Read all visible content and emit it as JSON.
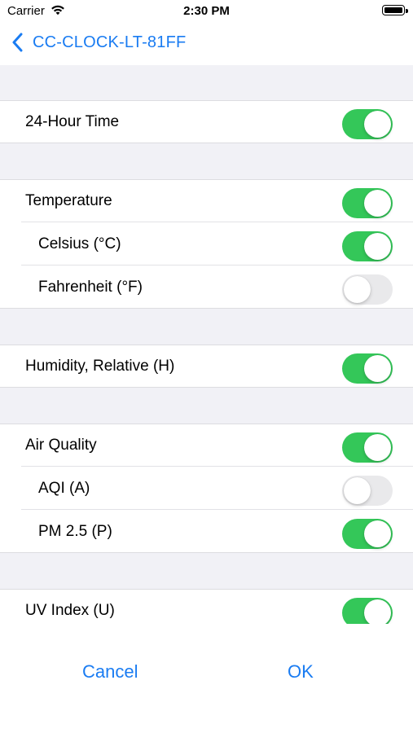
{
  "status_bar": {
    "carrier": "Carrier",
    "time": "2:30 PM"
  },
  "nav": {
    "back_title": "CC-CLOCK-LT-81FF"
  },
  "settings": [
    {
      "label": "24-Hour Time",
      "on": true
    },
    {
      "label": "Temperature",
      "on": true
    },
    {
      "label": "Celsius (°C)",
      "on": true
    },
    {
      "label": "Fahrenheit (°F)",
      "on": false
    },
    {
      "label": "Humidity, Relative (H)",
      "on": true
    },
    {
      "label": "Air Quality",
      "on": true
    },
    {
      "label": "AQI (A)",
      "on": false
    },
    {
      "label": "PM 2.5 (P)",
      "on": true
    },
    {
      "label": "UV Index (U)",
      "on": true
    }
  ],
  "footer": {
    "cancel_label": "Cancel",
    "ok_label": "OK"
  },
  "colors": {
    "accent": "#1a7cf2",
    "toggle_on": "#34c759",
    "toggle_off": "#e9e9eb",
    "group_background": "#f1f1f6"
  },
  "icons": {
    "back": "chevron-left-icon",
    "wifi": "wifi-icon",
    "battery": "battery-icon"
  }
}
